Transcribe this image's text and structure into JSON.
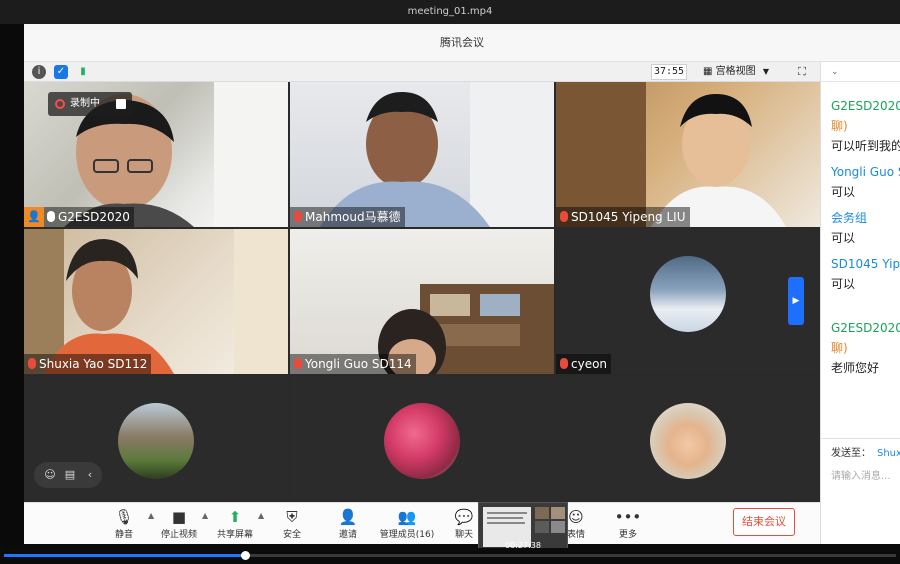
{
  "player": {
    "file_title": "meeting_01.mp4",
    "progress": 0.27,
    "preview_time": "00:27:38"
  },
  "app": {
    "title": "腾讯会议",
    "timer": "37:55",
    "view_mode": "宫格视图",
    "recording_label": "录制中"
  },
  "tiles": [
    {
      "name": "G2ESD2020",
      "type": "video"
    },
    {
      "name": "Mahmoud马慕德",
      "type": "video"
    },
    {
      "name": "SD1045 Yipeng LIU",
      "type": "video"
    },
    {
      "name": "Shuxia Yao SD112",
      "type": "video"
    },
    {
      "name": "Yongli Guo SD114",
      "type": "video"
    },
    {
      "name": "cyeon",
      "type": "avatar"
    },
    {
      "name": "",
      "type": "avatar"
    },
    {
      "name": "",
      "type": "avatar"
    },
    {
      "name": "",
      "type": "avatar"
    }
  ],
  "toolbar": {
    "mute": "静音",
    "stop_video": "停止视频",
    "share_screen": "共享屏幕",
    "security": "安全",
    "invite": "邀请",
    "manage_members": "管理成员(16)",
    "chat": "聊天",
    "reactions": "表情",
    "more": "更多",
    "end_meeting": "结束会议"
  },
  "chat": {
    "messages": [
      {
        "sender": "G2ESD2020",
        "tag": "聊)",
        "text": "可以听到我的"
      },
      {
        "sender": "Yongli Guo S",
        "tag": "",
        "text": "可以"
      },
      {
        "sender": "会务组",
        "tag": "",
        "text": "可以"
      },
      {
        "sender": "SD1045 Yipe",
        "tag": "",
        "text": "可以"
      },
      {
        "sender": "G2ESD2020",
        "tag": "聊)",
        "text": "老师您好"
      }
    ],
    "send_to_label": "发送至：",
    "send_to_value": "Shux",
    "input_placeholder": "请输入消息..."
  },
  "colors": {
    "accent_blue": "#1a8cd8",
    "end_red": "#e74c3c",
    "player_progress": "#1e78ff"
  }
}
